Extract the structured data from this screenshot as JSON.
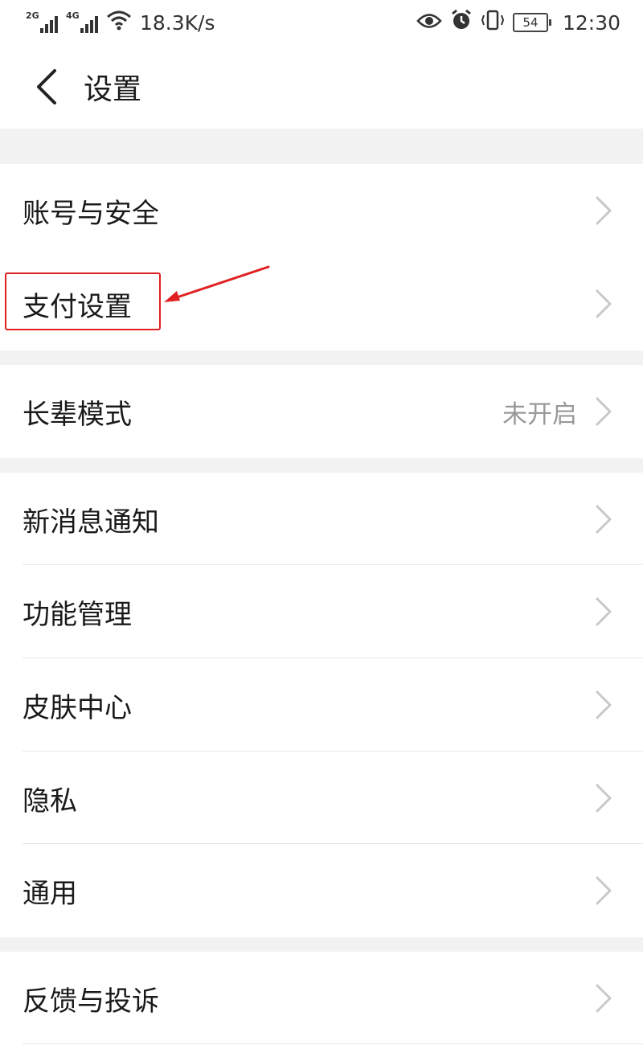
{
  "status_bar": {
    "net1": "2G",
    "net2": "4G",
    "speed": "18.3K/s",
    "battery": "54",
    "time": "12:30",
    "icons": [
      "signal-icon",
      "signal-icon",
      "wifi-icon",
      "eye-icon",
      "alarm-icon",
      "vibrate-icon",
      "battery-icon"
    ]
  },
  "header": {
    "title": "设置",
    "back_icon": "chevron-left-icon"
  },
  "items": {
    "account_security": "账号与安全",
    "payment_settings": "支付设置",
    "elder_mode": "长辈模式",
    "elder_mode_value": "未开启",
    "new_message_notify": "新消息通知",
    "feature_management": "功能管理",
    "skin_center": "皮肤中心",
    "privacy": "隐私",
    "general": "通用",
    "feedback_complaint": "反馈与投诉"
  },
  "colors": {
    "section_gap": "#f2f2f2",
    "chevron": "#c8c8c8",
    "annotation": "#e02020"
  }
}
